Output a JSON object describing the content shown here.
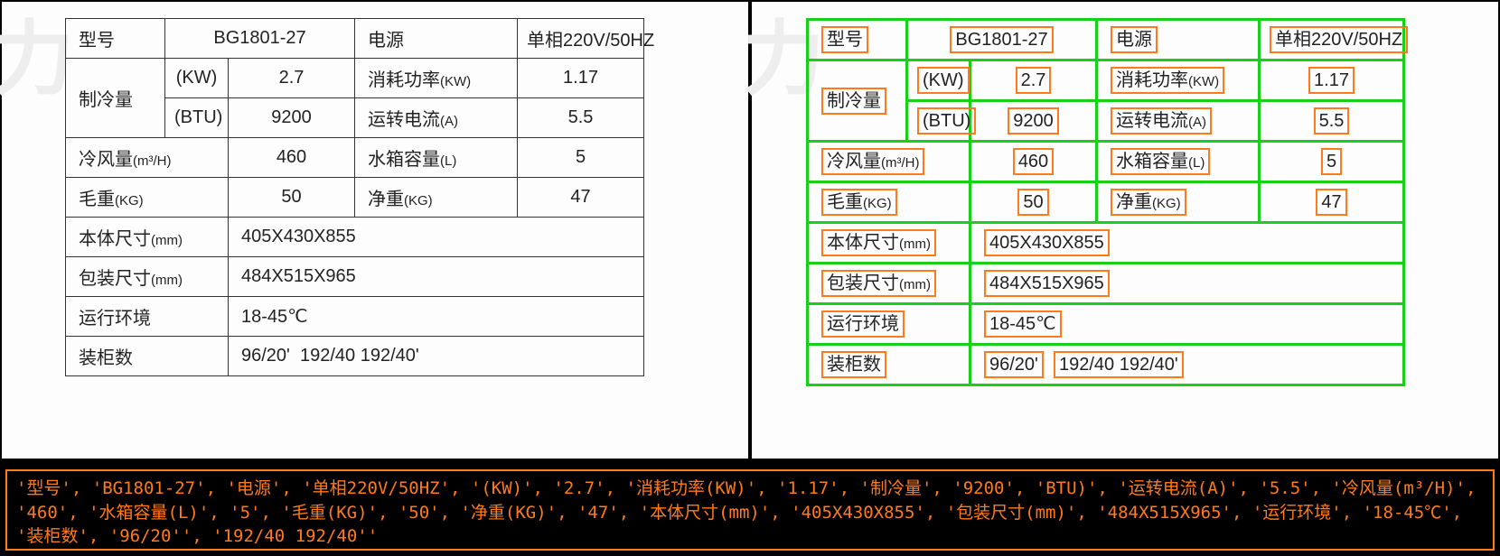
{
  "watermark": "力",
  "labels": {
    "model": "型号",
    "power": "电源",
    "cooling": "制冷量",
    "kw": "(KW)",
    "btu": "(BTU)",
    "consume": "消耗功率",
    "consume_unit": "(KW)",
    "current": "运转电流",
    "current_unit": "(A)",
    "airflow": "冷风量",
    "airflow_unit": "(m³/H)",
    "tank": "水箱容量",
    "tank_unit": "(L)",
    "gross": "毛重",
    "gross_unit": "(KG)",
    "net": "净重",
    "net_unit": "(KG)",
    "body": "本体尺寸",
    "body_unit": "(mm)",
    "pack": "包装尺寸",
    "pack_unit": "(mm)",
    "env": "运行环境",
    "load": "装柜数"
  },
  "values": {
    "model": "BG1801-27",
    "power": "单相220V/50HZ",
    "kw": "2.7",
    "btu": "9200",
    "consume": "1.17",
    "current": "5.5",
    "airflow": "460",
    "tank": "5",
    "gross": "50",
    "net": "47",
    "body": "405X430X855",
    "pack": "484X515X965",
    "env": "18-45℃",
    "load_a": "96/20'",
    "load_b": "192/40 192/40'"
  },
  "footer_text": "'型号', 'BG1801-27', '电源', '单相220V/50HZ', '(KW)', '2.7', '消耗功率(KW)', '1.17', '制冷量', '9200', 'BTU)', '运转电流(A)', '5.5', '冷风量(m³/H)', '460', '水箱容量(L)', '5', '毛重(KG)', '50', '净重(KG)', '47', '本体尺寸(mm)', '405X430X855', '包装尺寸(mm)', '484X515X965', '运行环境', '18-45℃', '装柜数', '96/20'', '192/40 192/40''"
}
